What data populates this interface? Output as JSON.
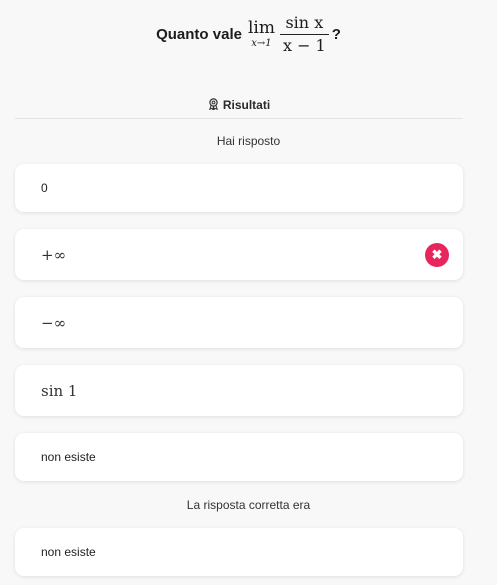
{
  "question": {
    "lead": "Quanto vale",
    "lim_op": "lim",
    "lim_sub": "x→1",
    "numerator": "sin x",
    "denominator": "x − 1",
    "qmark": "?"
  },
  "results": {
    "title": "Risultati",
    "icon": "award-badge-icon"
  },
  "your_answer_caption": "Hai risposto",
  "options": [
    {
      "label": "0",
      "math": false,
      "selected_wrong": false
    },
    {
      "label": "+∞",
      "math": true,
      "selected_wrong": true
    },
    {
      "label": "−∞",
      "math": true,
      "selected_wrong": false
    },
    {
      "label": "sin 1",
      "math": true,
      "selected_wrong": false
    },
    {
      "label": "non esiste",
      "math": false,
      "selected_wrong": false
    }
  ],
  "wrong_mark_symbol": "✖",
  "correct_caption": "La risposta corretta era",
  "correct_answer": {
    "label": "non esiste"
  },
  "colors": {
    "wrong_accent": "#e8265e",
    "background": "#f8f8f9",
    "card": "#ffffff"
  }
}
